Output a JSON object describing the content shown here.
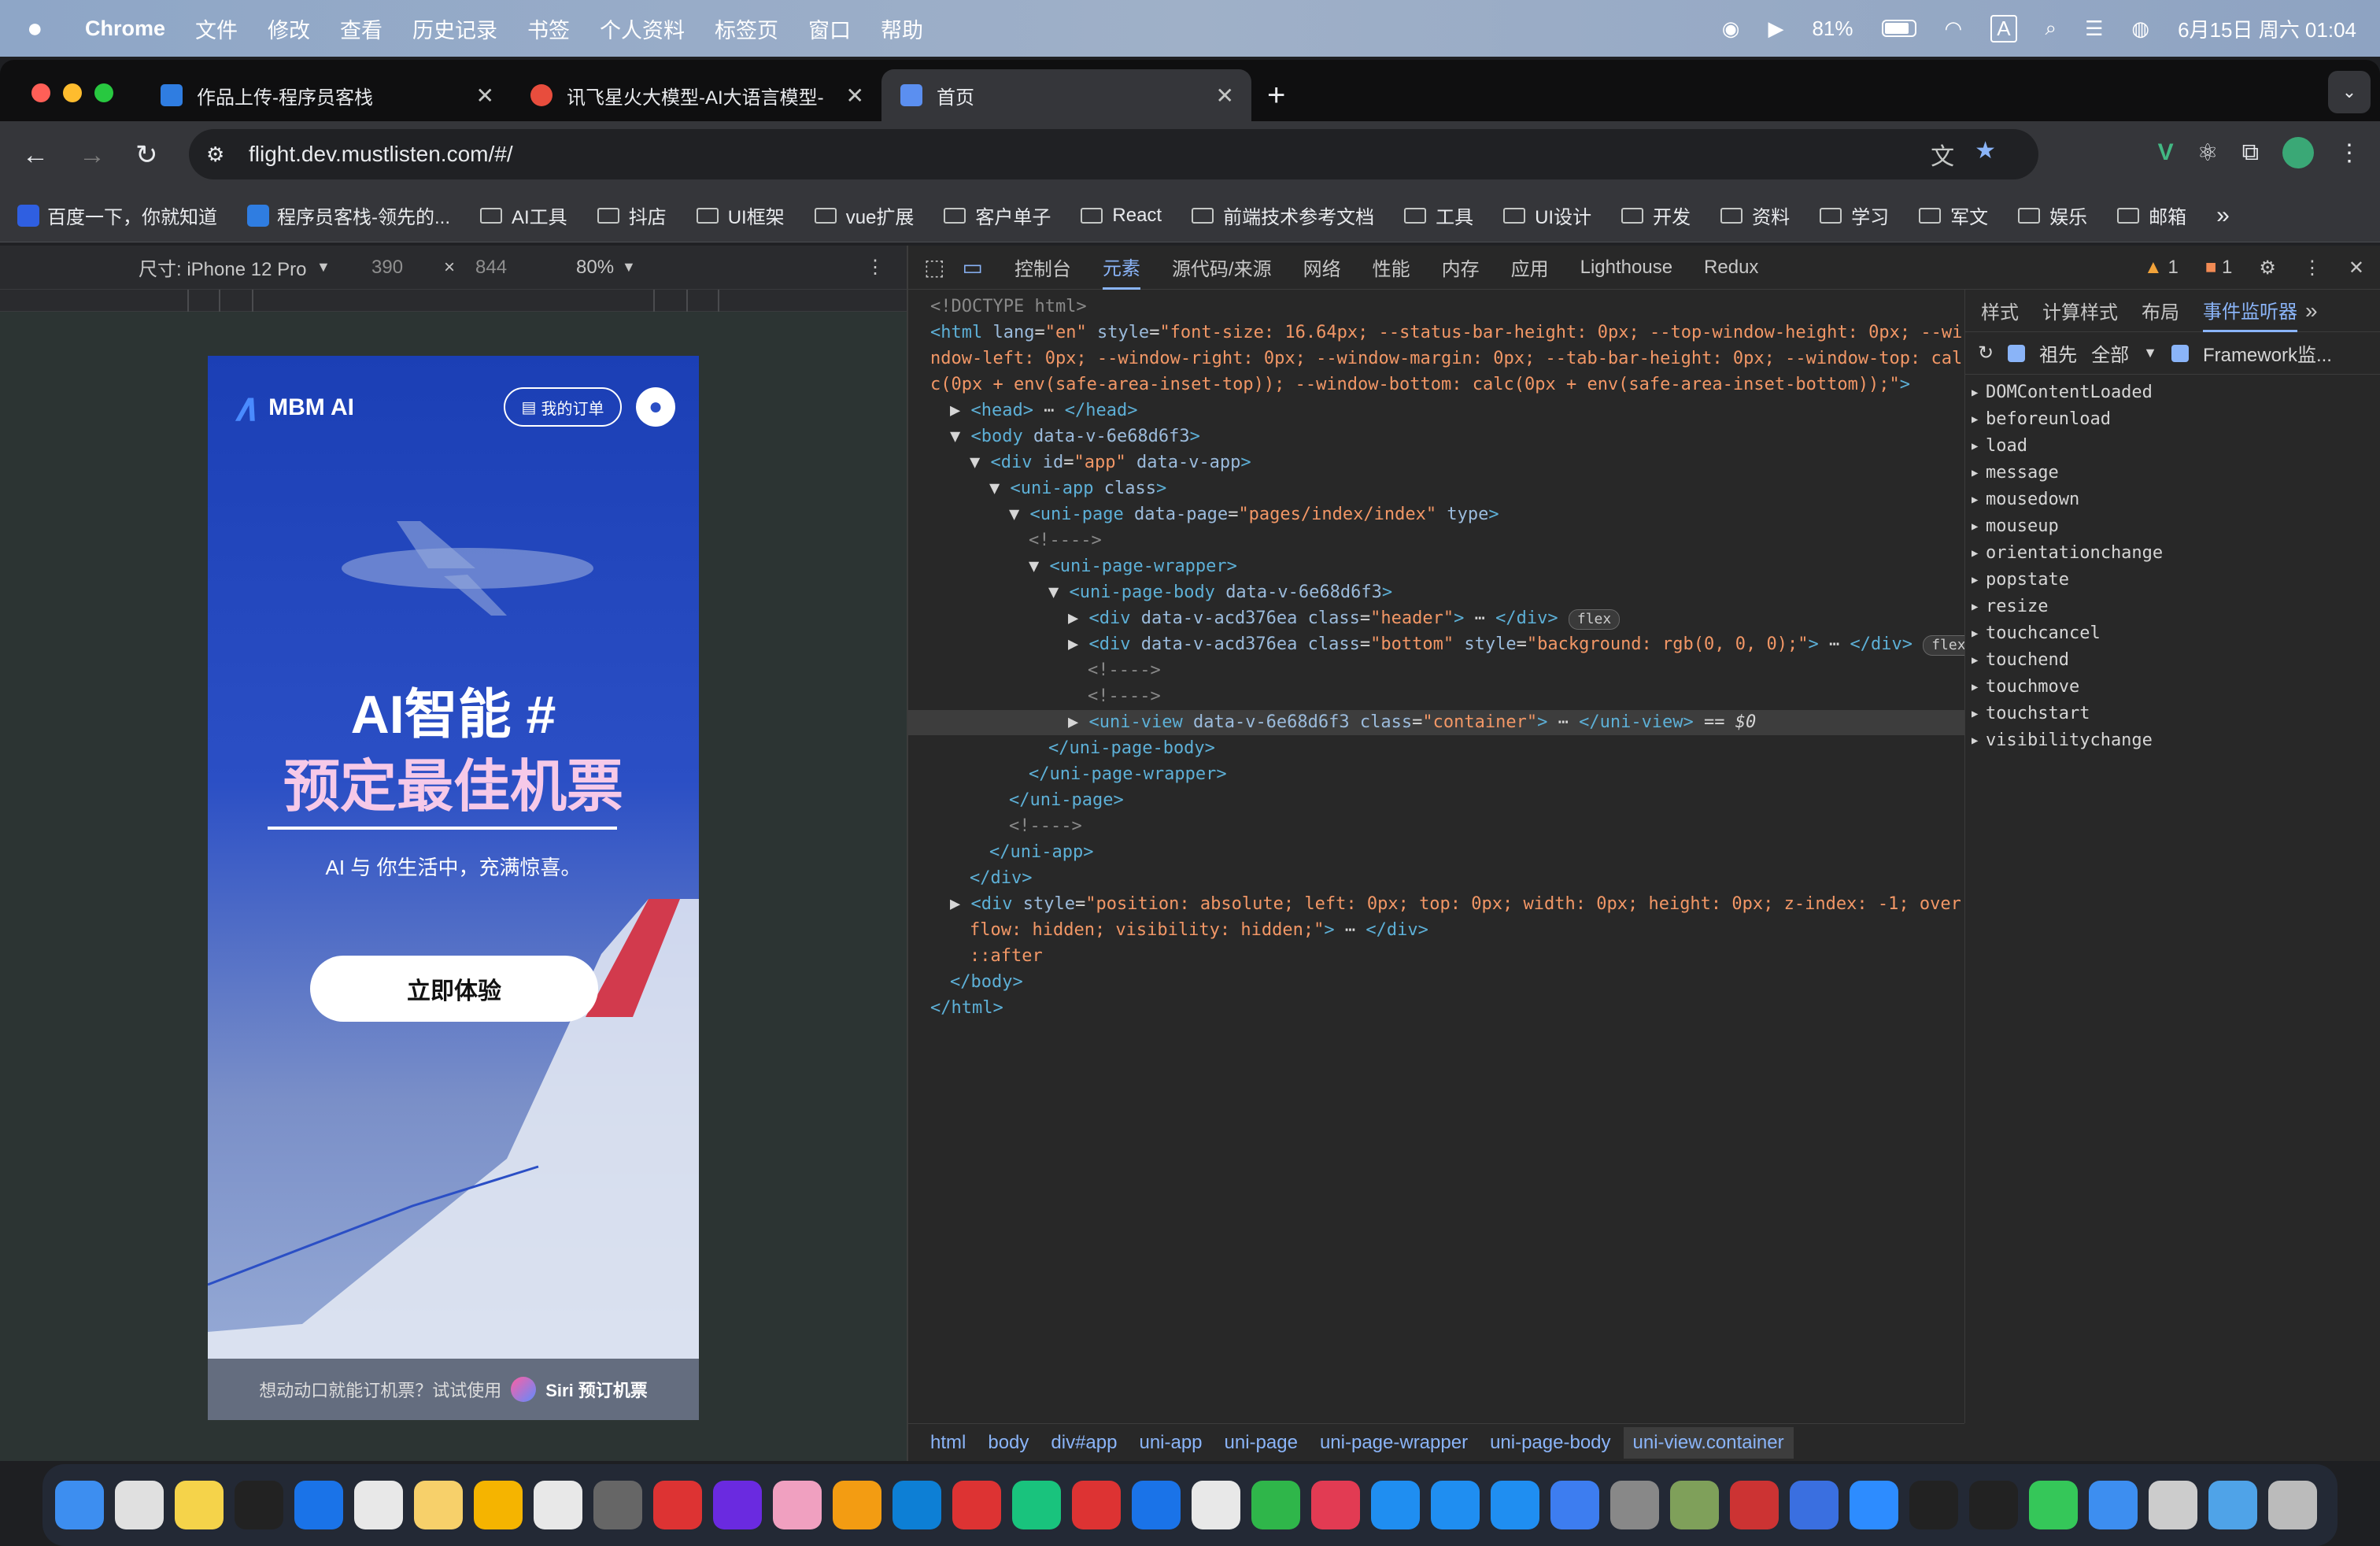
{
  "menubar": {
    "app_name": "Chrome",
    "items": [
      "文件",
      "修改",
      "查看",
      "历史记录",
      "书签",
      "个人资料",
      "标签页",
      "窗口",
      "帮助"
    ],
    "battery": "81%",
    "input_method": "A",
    "datetime": "6月15日 周六 01:04"
  },
  "tabs": [
    {
      "title": "作品上传-程序员客栈",
      "favicon_color": "#2f7de1"
    },
    {
      "title": "讯飞星火大模型-AI大语言模型-",
      "favicon_color": "#e84d3d"
    },
    {
      "title": "首页",
      "favicon_color": "#5b8ff0"
    }
  ],
  "toolbar": {
    "url": "flight.dev.mustlisten.com/#/"
  },
  "bookmarks": [
    {
      "label": "百度一下，你就知道",
      "type": "site",
      "color": "#2f5fe1"
    },
    {
      "label": "程序员客栈-领先的...",
      "type": "site",
      "color": "#2f7de1"
    },
    {
      "label": "AI工具",
      "type": "folder"
    },
    {
      "label": "抖店",
      "type": "folder"
    },
    {
      "label": "UI框架",
      "type": "folder"
    },
    {
      "label": "vue扩展",
      "type": "folder"
    },
    {
      "label": "客户单子",
      "type": "folder"
    },
    {
      "label": "React",
      "type": "folder"
    },
    {
      "label": "前端技术参考文档",
      "type": "folder"
    },
    {
      "label": "工具",
      "type": "folder"
    },
    {
      "label": "UI设计",
      "type": "folder"
    },
    {
      "label": "开发",
      "type": "folder"
    },
    {
      "label": "资料",
      "type": "folder"
    },
    {
      "label": "学习",
      "type": "folder"
    },
    {
      "label": "军文",
      "type": "folder"
    },
    {
      "label": "娱乐",
      "type": "folder"
    },
    {
      "label": "邮箱",
      "type": "folder"
    }
  ],
  "device_toolbar": {
    "size_label": "尺寸: iPhone 12 Pro",
    "width": "390",
    "times": "×",
    "height": "844",
    "zoom": "80%"
  },
  "phone": {
    "logo": "MBM AI",
    "order_button": "我的订单",
    "hero_line1": "AI智能 #",
    "hero_line2": "预定最佳机票",
    "hero_sub": "AI 与 你生活中，充满惊喜。",
    "cta": "立即体验",
    "footer_text": "想动动口就能订机票？试试使用",
    "footer_link": "Siri 预订机票"
  },
  "devtools": {
    "tabs": [
      "控制台",
      "元素",
      "源代码/来源",
      "网络",
      "性能",
      "内存",
      "应用",
      "Lighthouse",
      "Redux"
    ],
    "active_tab": "元素",
    "warnings": "1",
    "errors": "1",
    "sidebar_tabs": [
      "样式",
      "计算样式",
      "布局",
      "事件监听器"
    ],
    "sidebar_active": "事件监听器",
    "filter_ancestors": "祖先",
    "filter_all": "全部",
    "filter_framework": "Framework监...",
    "events": [
      "DOMContentLoaded",
      "beforeunload",
      "load",
      "message",
      "mousedown",
      "mouseup",
      "orientationchange",
      "popstate",
      "resize",
      "touchcancel",
      "touchend",
      "touchmove",
      "touchstart",
      "visibilitychange"
    ],
    "breadcrumbs": [
      "html",
      "body",
      "div#app",
      "uni-app",
      "uni-page",
      "uni-page-wrapper",
      "uni-page-body",
      "uni-view.container"
    ]
  },
  "dom_lines": [
    {
      "indent": 0,
      "html": "<span class='cm'>&lt;!DOCTYPE html&gt;</span>"
    },
    {
      "indent": 0,
      "html": "<span class='tg'>&lt;html</span> <span class='an'>lang</span>=<span class='av'>\"en\"</span> <span class='an'>style</span>=<span class='av'>\"font-size: 16.64px; --status-bar-height: 0px; --top-window-height: 0px; --wi</span>"
    },
    {
      "indent": 0,
      "html": "<span class='av'>ndow-left: 0px; --window-right: 0px; --window-margin: 0px; --tab-bar-height: 0px; --window-top: cal</span>"
    },
    {
      "indent": 0,
      "html": "<span class='av'>c(0px + env(safe-area-inset-top)); --window-bottom: calc(0px + env(safe-area-inset-bottom));\"</span><span class='tg'>&gt;</span>"
    },
    {
      "indent": 1,
      "html": "▶ <span class='tg'>&lt;head&gt;</span> ⋯ <span class='tg'>&lt;/head&gt;</span>"
    },
    {
      "indent": 1,
      "html": "▼ <span class='tg'>&lt;body</span> <span class='an'>data-v-6e68d6f3</span><span class='tg'>&gt;</span>"
    },
    {
      "indent": 2,
      "html": "▼ <span class='tg'>&lt;div</span> <span class='an'>id</span>=<span class='av'>\"app\"</span> <span class='an'>data-v-app</span><span class='tg'>&gt;</span>"
    },
    {
      "indent": 3,
      "html": "▼ <span class='tg'>&lt;uni-app</span> <span class='an'>class</span><span class='tg'>&gt;</span>"
    },
    {
      "indent": 4,
      "html": "▼ <span class='tg'>&lt;uni-page</span> <span class='an'>data-page</span>=<span class='av'>\"pages/index/index\"</span> <span class='an'>type</span><span class='tg'>&gt;</span>"
    },
    {
      "indent": 5,
      "html": "<span class='cm'>&lt;!----&gt;</span>"
    },
    {
      "indent": 5,
      "html": "▼ <span class='tg'>&lt;uni-page-wrapper&gt;</span>"
    },
    {
      "indent": 6,
      "html": "▼ <span class='tg'>&lt;uni-page-body</span> <span class='an'>data-v-6e68d6f3</span><span class='tg'>&gt;</span>"
    },
    {
      "indent": 7,
      "html": "▶ <span class='tg'>&lt;div</span> <span class='an'>data-v-acd376ea</span> <span class='an'>class</span>=<span class='av'>\"header\"</span><span class='tg'>&gt;</span> ⋯ <span class='tg'>&lt;/div&gt;</span> <span class='badge'>flex</span>"
    },
    {
      "indent": 7,
      "html": "▶ <span class='tg'>&lt;div</span> <span class='an'>data-v-acd376ea</span> <span class='an'>class</span>=<span class='av'>\"bottom\"</span> <span class='an'>style</span>=<span class='av'>\"background: rgb(0, 0, 0);\"</span><span class='tg'>&gt;</span> ⋯ <span class='tg'>&lt;/div&gt;</span> <span class='badge'>flex</span>"
    },
    {
      "indent": 8,
      "html": "<span class='cm'>&lt;!----&gt;</span>"
    },
    {
      "indent": 8,
      "html": "<span class='cm'>&lt;!----&gt;</span>"
    },
    {
      "indent": 7,
      "html": "▶ <span class='tg'>&lt;uni-view</span> <span class='an'>data-v-6e68d6f3</span> <span class='an'>class</span>=<span class='av'>\"container\"</span><span class='tg'>&gt;</span> ⋯ <span class='tg'>&lt;/uni-view&gt;</span> == <i>$0</i>",
      "selected": true
    },
    {
      "indent": 6,
      "html": "<span class='tg'>&lt;/uni-page-body&gt;</span>"
    },
    {
      "indent": 5,
      "html": "<span class='tg'>&lt;/uni-page-wrapper&gt;</span>"
    },
    {
      "indent": 4,
      "html": "<span class='tg'>&lt;/uni-page&gt;</span>"
    },
    {
      "indent": 4,
      "html": "<span class='cm'>&lt;!----&gt;</span>"
    },
    {
      "indent": 3,
      "html": "<span class='tg'>&lt;/uni-app&gt;</span>"
    },
    {
      "indent": 2,
      "html": "<span class='tg'>&lt;/div&gt;</span>"
    },
    {
      "indent": 1,
      "html": "▶ <span class='tg'>&lt;div</span> <span class='an'>style</span>=<span class='av'>\"position: absolute; left: 0px; top: 0px; width: 0px; height: 0px; z-index: -1; over</span>"
    },
    {
      "indent": 2,
      "html": "<span class='av'>flow: hidden; visibility: hidden;\"</span><span class='tg'>&gt;</span> ⋯ <span class='tg'>&lt;/div&gt;</span>"
    },
    {
      "indent": 2,
      "html": "<span class='av'>::after</span>"
    },
    {
      "indent": 1,
      "html": "<span class='tg'>&lt;/body&gt;</span>"
    },
    {
      "indent": 0,
      "html": "<span class='tg'>&lt;/html&gt;</span>"
    }
  ],
  "dock_apps": [
    "finder",
    "launchpad",
    "notes",
    "qq",
    "maps",
    "wechat-work",
    "baidu-netdisk",
    "feishu",
    "dingtalk",
    "calculator",
    "wps",
    "jetbrains-toolbox",
    "photos",
    "sublime",
    "vscode",
    "youdao",
    "music",
    "netease-music",
    "safari",
    "chrome",
    "wechat",
    "huawei-appgallery",
    "app-store",
    "testflight",
    "xcode",
    "lark",
    "system-settings",
    "pinhole",
    "remote-desktop",
    "screen-sharing",
    "zoom",
    "activity-monitor",
    "terminal",
    "messages",
    "feishu-doc",
    "preview",
    "downloads",
    "trash"
  ]
}
